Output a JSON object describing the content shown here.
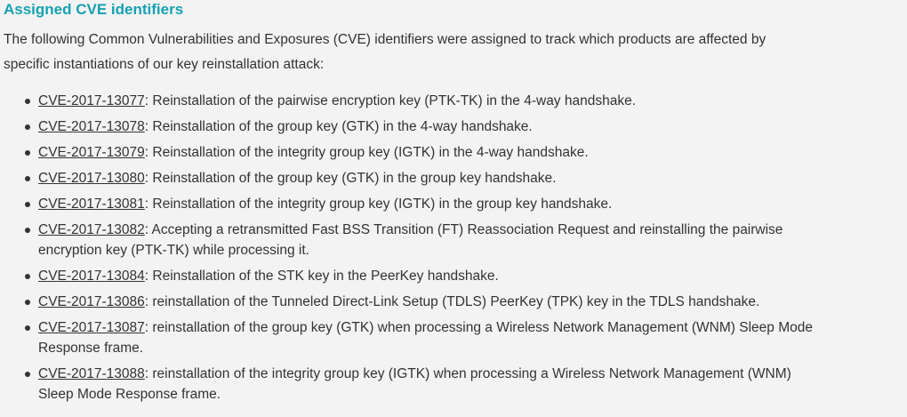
{
  "section": {
    "title": "Assigned CVE identifiers",
    "intro": "The following Common Vulnerabilities and Exposures (CVE) identifiers were assigned to track which products are affected by specific instantiations of our key reinstallation attack:"
  },
  "cves": [
    {
      "id": "CVE-2017-13077",
      "desc": ": Reinstallation of the pairwise encryption key (PTK-TK) in the 4-way handshake."
    },
    {
      "id": "CVE-2017-13078",
      "desc": ": Reinstallation of the group key (GTK) in the 4-way handshake."
    },
    {
      "id": "CVE-2017-13079",
      "desc": ": Reinstallation of the integrity group key (IGTK) in the 4-way handshake."
    },
    {
      "id": "CVE-2017-13080",
      "desc": ": Reinstallation of the group key (GTK) in the group key handshake."
    },
    {
      "id": "CVE-2017-13081",
      "desc": ": Reinstallation of the integrity group key (IGTK) in the group key handshake."
    },
    {
      "id": "CVE-2017-13082",
      "desc": ": Accepting a retransmitted Fast BSS Transition (FT) Reassociation Request and reinstalling the pairwise encryption key (PTK-TK) while processing it."
    },
    {
      "id": "CVE-2017-13084",
      "desc": ": Reinstallation of the STK key in the PeerKey handshake."
    },
    {
      "id": "CVE-2017-13086",
      "desc": ": reinstallation of the Tunneled Direct-Link Setup (TDLS) PeerKey (TPK) key in the TDLS handshake."
    },
    {
      "id": "CVE-2017-13087",
      "desc": ": reinstallation of the group key (GTK) when processing a Wireless Network Management (WNM) Sleep Mode Response frame."
    },
    {
      "id": "CVE-2017-13088",
      "desc": ": reinstallation of the integrity group key (IGTK) when processing a Wireless Network Management (WNM) Sleep Mode Response frame."
    }
  ],
  "colors": {
    "heading": "#17a1b2",
    "text": "#333333",
    "background": "#f3f3f3"
  }
}
